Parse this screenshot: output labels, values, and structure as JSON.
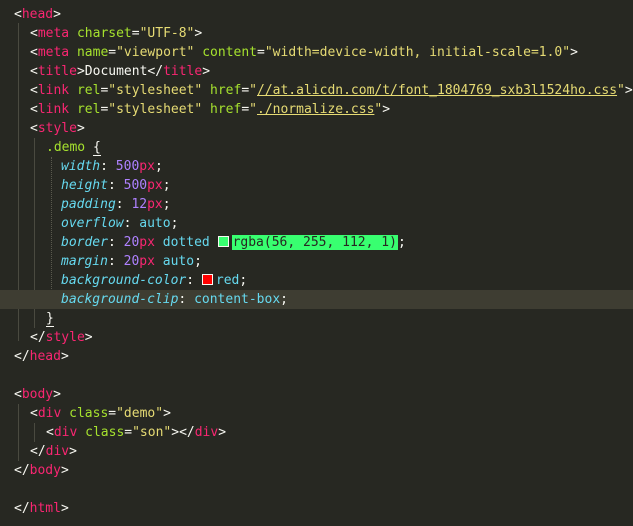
{
  "editor": {
    "lines": {
      "l1": {
        "open": "<",
        "tag": "head",
        "close": ">"
      },
      "l2": {
        "open": "<",
        "tag": "meta",
        "attr1": "charset",
        "eq1": "=",
        "val1": "\"UTF-8\"",
        "close": ">"
      },
      "l3": {
        "open": "<",
        "tag": "meta",
        "attr1": "name",
        "eq1": "=",
        "val1": "\"viewport\"",
        "attr2": "content",
        "eq2": "=",
        "val2": "\"width=device-width, initial-scale=1.0\"",
        "close": ">"
      },
      "l4": {
        "open": "<",
        "tag": "title",
        "close": ">",
        "text": "Document",
        "end_open": "</",
        "end_tag": "title",
        "end_close": ">"
      },
      "l5": {
        "open": "<",
        "tag": "link",
        "attr1": "rel",
        "eq1": "=",
        "val1": "\"stylesheet\"",
        "attr2": "href",
        "eq2": "=",
        "q_open": "\"",
        "url": "//at.alicdn.com/t/font_1804769_sxb3l1524ho.css",
        "q_close": "\"",
        "close": ">"
      },
      "l6": {
        "open": "<",
        "tag": "link",
        "attr1": "rel",
        "eq1": "=",
        "val1": "\"stylesheet\"",
        "attr2": "href",
        "eq2": "=",
        "q_open": "\"",
        "url": "./normalize.css",
        "q_close": "\"",
        "close": ">"
      },
      "l7": {
        "open": "<",
        "tag": "style",
        "close": ">"
      },
      "l8": {
        "selector": ".demo",
        "brace": "{"
      },
      "l9": {
        "prop": "width",
        "colon": ": ",
        "num": "500",
        "unit": "px",
        "semi": ";"
      },
      "l10": {
        "prop": "height",
        "colon": ": ",
        "num": "500",
        "unit": "px",
        "semi": ";"
      },
      "l11": {
        "prop": "padding",
        "colon": ": ",
        "num": "12",
        "unit": "px",
        "semi": ";"
      },
      "l12": {
        "prop": "overflow",
        "colon": ": ",
        "val": "auto",
        "semi": ";"
      },
      "l13": {
        "prop": "border",
        "colon": ": ",
        "num": "20",
        "unit": "px",
        "val": " dotted ",
        "rgba": "rgba(56, 255, 112, 1)",
        "semi": ";"
      },
      "l14": {
        "prop": "margin",
        "colon": ": ",
        "num": "20",
        "unit": "px",
        "val": " auto",
        "semi": ";"
      },
      "l15": {
        "prop": "background-color",
        "colon": ": ",
        "val": "red",
        "semi": ";"
      },
      "l16": {
        "prop": "background-clip",
        "colon": ": ",
        "val": "content-box",
        "semi": ";"
      },
      "l17": {
        "brace": "}"
      },
      "l18": {
        "open": "</",
        "tag": "style",
        "close": ">"
      },
      "l19": {
        "open": "</",
        "tag": "head",
        "close": ">"
      },
      "l21": {
        "open": "<",
        "tag": "body",
        "close": ">"
      },
      "l22": {
        "open": "<",
        "tag": "div",
        "attr1": "class",
        "eq1": "=",
        "val1": "\"demo\"",
        "close": ">"
      },
      "l23": {
        "open": "<",
        "tag": "div",
        "attr1": "class",
        "eq1": "=",
        "val1": "\"son\"",
        "close": ">",
        "end_open": "</",
        "end_tag": "div",
        "end_close": ">"
      },
      "l24": {
        "open": "</",
        "tag": "div",
        "close": ">"
      },
      "l25": {
        "open": "</",
        "tag": "body",
        "close": ">"
      },
      "l27": {
        "open": "</",
        "tag": "html",
        "close": ">"
      }
    },
    "colors": {
      "background": "#272822",
      "tag": "#f92672",
      "attribute": "#a6e22e",
      "string": "#e6db74",
      "property": "#66d9ef",
      "number": "#ae81ff",
      "swatch_green": "#38ff70",
      "swatch_red": "#ff0000"
    }
  }
}
